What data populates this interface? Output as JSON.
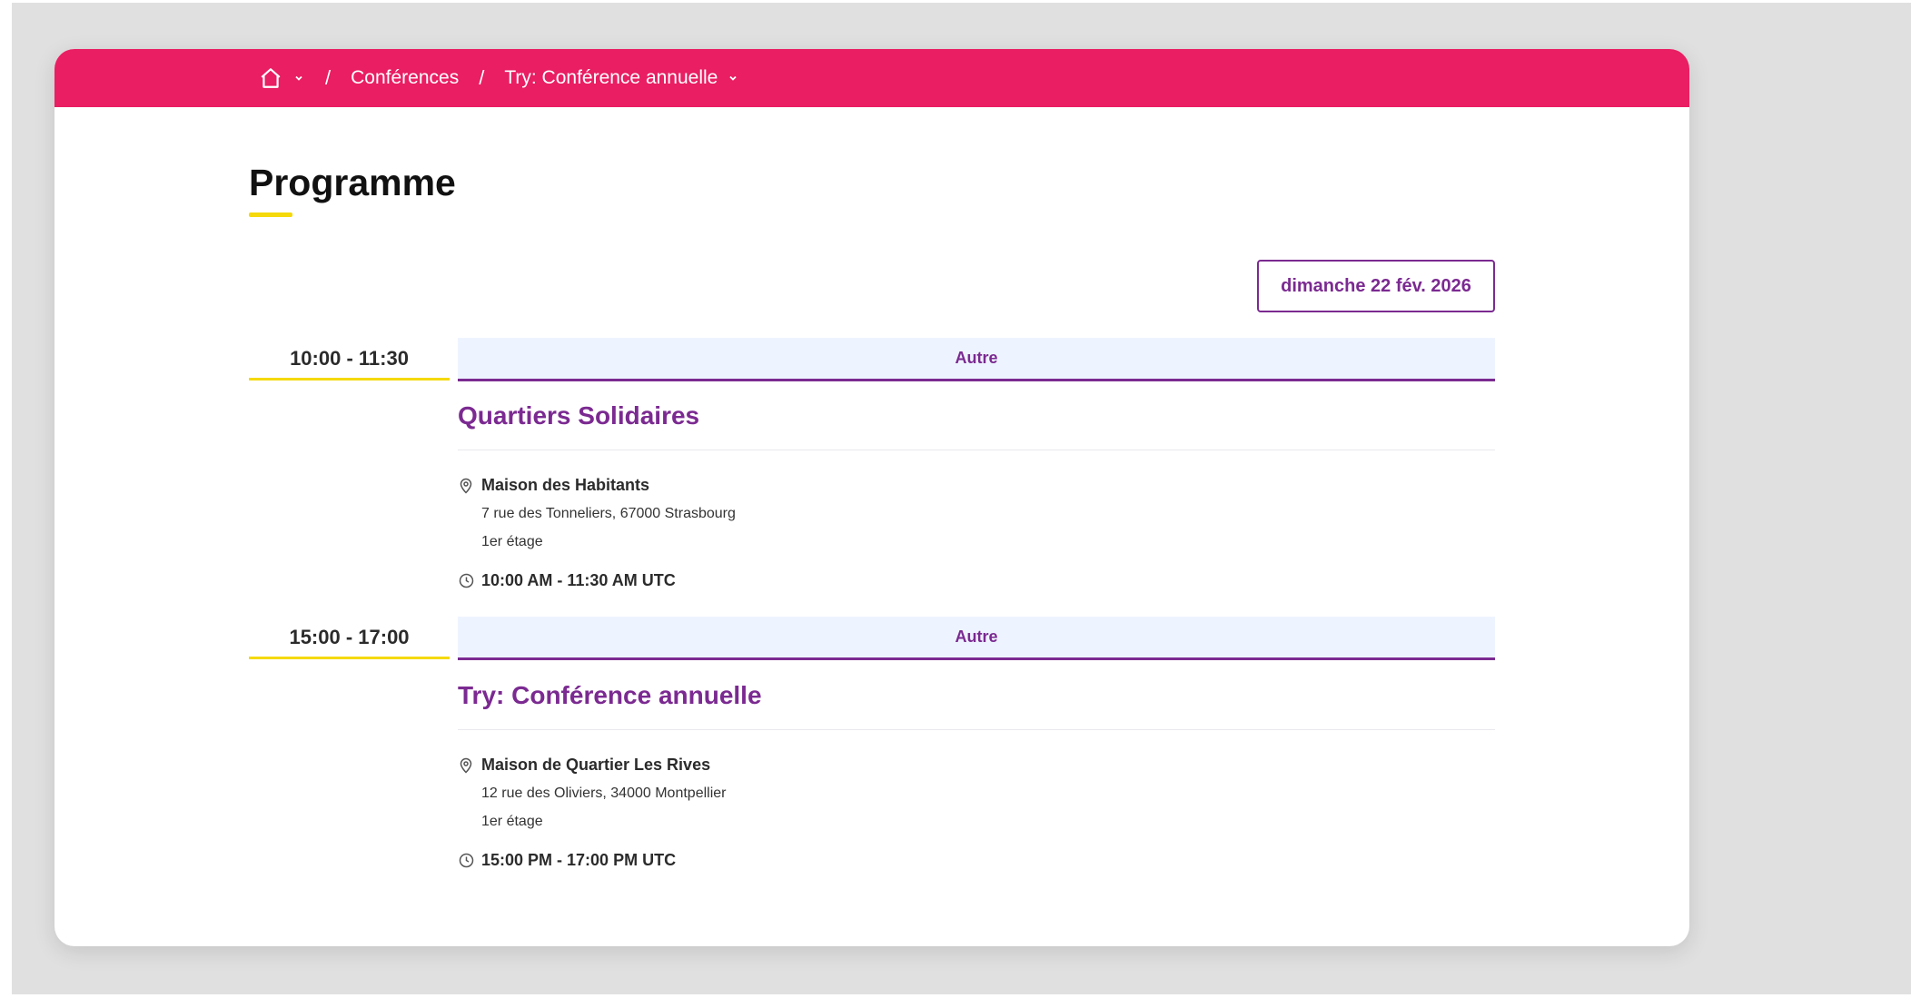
{
  "breadcrumb": {
    "home_icon": "home-icon",
    "items": [
      "Conférences",
      "Try: Conférence annuelle"
    ],
    "separator": "/"
  },
  "page": {
    "title": "Programme"
  },
  "date_selector": {
    "label": "dimanche 22 fév. 2026"
  },
  "events": [
    {
      "slot": "10:00 - 11:30",
      "category": "Autre",
      "title": "Quartiers Solidaires",
      "venue_name": "Maison des Habitants",
      "address": "7 rue des Tonneliers, 67000 Strasbourg",
      "floor": "1er étage",
      "time": "10:00 AM - 11:30 AM UTC"
    },
    {
      "slot": "15:00 - 17:00",
      "category": "Autre",
      "title": "Try: Conférence annuelle",
      "venue_name": "Maison de Quartier Les Rives",
      "address": "12 rue des Oliviers, 34000 Montpellier",
      "floor": "1er étage",
      "time": "15:00 PM - 17:00 PM UTC"
    }
  ],
  "colors": {
    "topbar": "#e91e63",
    "accent": "#7b2a91",
    "highlight": "#f5d90a",
    "band": "#eef4ff"
  }
}
